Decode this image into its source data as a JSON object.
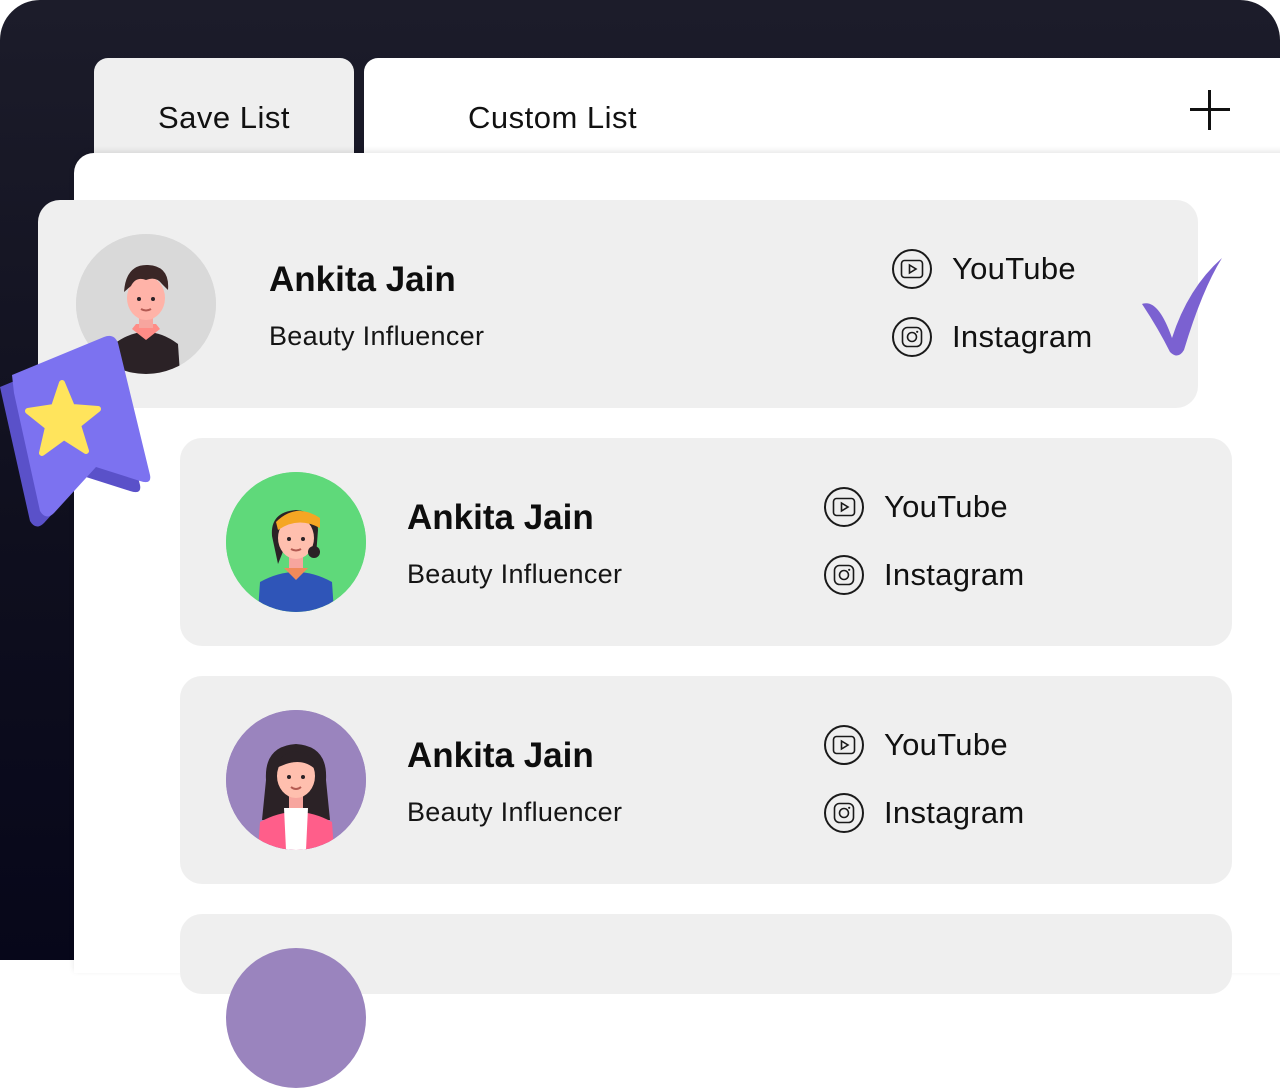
{
  "tabs": {
    "save_list": "Save List",
    "custom_list": "Custom List",
    "add_icon": "plus-icon"
  },
  "influencers": [
    {
      "name": "Ankita Jain",
      "role": "Beauty Influencer",
      "avatar_bg": "#d9d9d9",
      "selected": true,
      "platforms": [
        "YouTube",
        "Instagram"
      ]
    },
    {
      "name": "Ankita Jain",
      "role": "Beauty Influencer",
      "avatar_bg": "#5fd97a",
      "selected": false,
      "platforms": [
        "YouTube",
        "Instagram"
      ]
    },
    {
      "name": "Ankita Jain",
      "role": "Beauty Influencer",
      "avatar_bg": "#9a84be",
      "selected": false,
      "platforms": [
        "YouTube",
        "Instagram"
      ]
    }
  ],
  "icons": {
    "youtube": "youtube-icon",
    "instagram": "instagram-icon",
    "check": "checkmark-icon",
    "badge": "star-bookmark-icon"
  },
  "colors": {
    "accent": "#7b61d1",
    "badge": "#7c72f0",
    "star": "#ffe45c",
    "card": "#efefef",
    "dark": "#14141f"
  }
}
